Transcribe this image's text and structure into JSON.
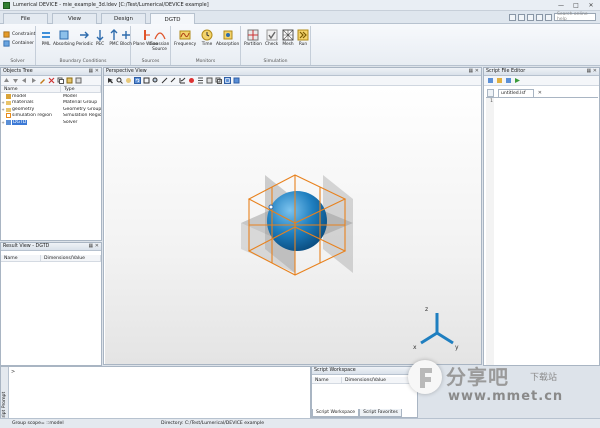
{
  "window": {
    "title": "Lumerical DEVICE - mie_example_3d.ldev [C:/Test/Lumerical/DEVICE example]",
    "controls": [
      "minimize-icon",
      "maximize-icon",
      "close-icon"
    ]
  },
  "ribbon_tabs": [
    {
      "label": "File",
      "active": false
    },
    {
      "label": "View",
      "active": false
    },
    {
      "label": "Design",
      "active": false
    },
    {
      "label": "DGTD",
      "active": true
    }
  ],
  "search": {
    "placeholder": "Search online help"
  },
  "ribbon": {
    "solver": {
      "label": "Solver",
      "constraint": "Constraint",
      "container": "Container"
    },
    "boundary": {
      "label": "Boundary Conditions",
      "buttons": [
        "PML",
        "Absorbing",
        "Periodic",
        "PEC",
        "PMC",
        "Bloch"
      ]
    },
    "sources": {
      "label": "Sources",
      "buttons": [
        "Plane Wave",
        "Gaussian Source"
      ]
    },
    "monitors": {
      "label": "Monitors",
      "buttons": [
        "Frequency",
        "Time",
        "Absorption"
      ]
    },
    "simulation": {
      "label": "Simulation",
      "buttons": [
        "Partition",
        "Check",
        "Mesh",
        "Run"
      ]
    }
  },
  "objects_tree": {
    "title": "Objects Tree",
    "columns": [
      "Name",
      "Type"
    ],
    "rows": [
      {
        "name": "model",
        "type": "Model",
        "expander": "",
        "selected": false
      },
      {
        "name": "materials",
        "type": "Material Group",
        "expander": "+",
        "selected": false
      },
      {
        "name": "geometry",
        "type": "Geometry Group",
        "expander": "+",
        "selected": false
      },
      {
        "name": "simulation region",
        "type": "Simulation Region",
        "expander": "",
        "selected": false
      },
      {
        "name": "DGTD",
        "type": "Solver",
        "expander": "+",
        "selected": true
      }
    ]
  },
  "result_view": {
    "title": "Result View - DGTD",
    "columns": [
      "Name",
      "Dimensions/Value"
    ]
  },
  "perspective": {
    "title": "Perspective View"
  },
  "script_editor": {
    "title": "Script File Editor",
    "file_tab": "untitled.lsf",
    "line_number": "1"
  },
  "script_prompt": {
    "title": "Script Prompt",
    "prompt_char": ">"
  },
  "script_workspace": {
    "title": "Script Workspace",
    "columns": [
      "Name",
      "Dimensions/Value"
    ],
    "tabs": [
      "Script Workspace",
      "Script Favorites"
    ]
  },
  "status": {
    "scope": "Group scope= ::model",
    "directory": "Directory: C:/Test/Lumerical/DEVICE example"
  },
  "watermark": {
    "cn": "分享吧",
    "cn_small": "下载站",
    "url": "www.mmet.cn"
  }
}
